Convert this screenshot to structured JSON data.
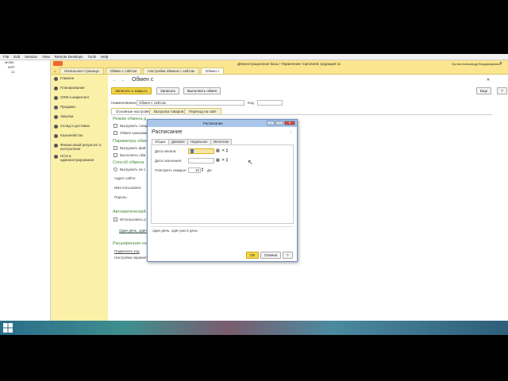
{
  "rd_menu": [
    "File",
    "Edit",
    "Session",
    "View",
    "Remote Desktops",
    "Tools",
    "Help"
  ],
  "rd_tree": [
    "MOBK",
    "MSP",
    "1C"
  ],
  "app": {
    "title": "Демонстрационная база / Управление торговлей, редакция 11  (1С:Предприятие)",
    "window_title": "Демонстрационная база / Управление торговлей, редакция 11",
    "user": "Орлов Александр Владимирович",
    "tabs": [
      "Начальная страница",
      "Обмен с сайтом",
      "Настройки обмена с сайтом",
      "Обмен с"
    ],
    "active_tab": 3,
    "sidebar": [
      "Главное",
      "Планирование",
      "CRM и маркетинг",
      "Продажи",
      "Закупки",
      "Склад и доставка",
      "Казначейство",
      "Финансовый результат и контроллинг",
      "НСИ и администрирование"
    ]
  },
  "form": {
    "title": "Обмен с",
    "save_close": "Записать и закрыть",
    "save": "Записать",
    "run": "Выполнить обмен",
    "more": "Еще",
    "help": "?",
    "name_label": "Наименование:",
    "name_value": "Обмен с сайтом",
    "code_label": "Код:",
    "tabs": [
      "Основные настройки",
      "Выгрузка товаров",
      "Переход на сайт"
    ],
    "section1": "Режим обмена д",
    "chk1": "Выгружать товар",
    "chk2": "Обмен заказами",
    "section2": "Параметры обмен",
    "chk3": "Выгружать фай",
    "chk4": "Выполнять обм",
    "section3": "Способ обмена",
    "radio1": "Выгружать на с",
    "addr_label": "Адрес сайта:",
    "user_label": "Имя пользовате",
    "pass_label": "Пароль:",
    "section4": "Автоматический",
    "chk5": "Использовать р",
    "schedule_link": "Один день, один",
    "section5": "Расширенная на",
    "link2": "Подменить код",
    "link3": "Настройка параметр"
  },
  "dialog": {
    "title": "Расписание",
    "heading": "Расписание",
    "tabs": [
      "Общие",
      "Дневное",
      "Недельное",
      "Месячное"
    ],
    "start_label": "Дата начала:",
    "start_value": ". .",
    "end_label": "Дата окончания:",
    "end_value": ". .",
    "repeat_label": "Повторять каждые:",
    "repeat_value": "10",
    "repeat_unit": "Дн.",
    "summary": "один день, один раз в день",
    "ok": "ОК",
    "cancel": "Отмена",
    "help": "?"
  }
}
